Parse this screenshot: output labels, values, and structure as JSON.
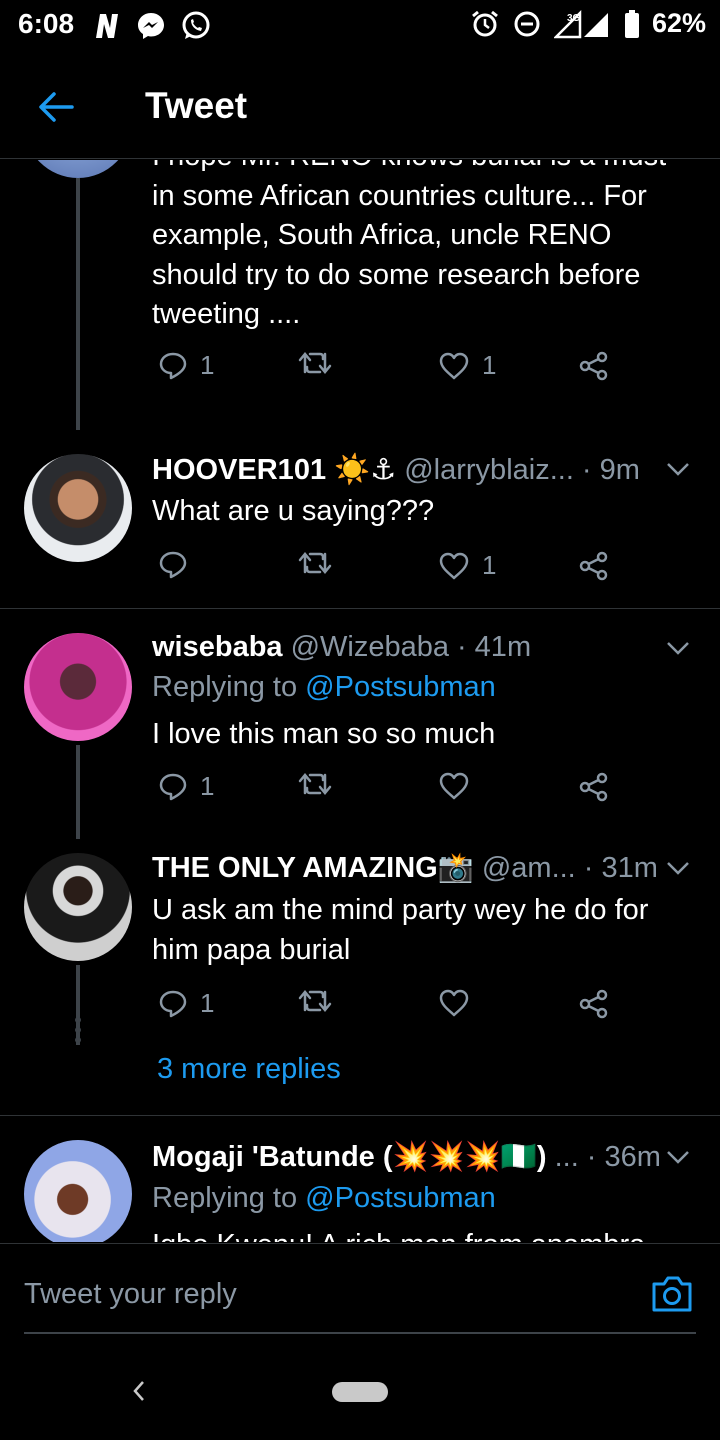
{
  "status_bar": {
    "time": "6:08",
    "network": "3G",
    "battery": "62%",
    "icons": [
      "netflix-icon",
      "messenger-icon",
      "whatsapp-icon",
      "alarm-icon",
      "dnd-icon",
      "signal-icon",
      "battery-icon"
    ]
  },
  "header": {
    "title": "Tweet",
    "back_icon": "arrow-left-icon"
  },
  "colors": {
    "accent": "#1d9bf0",
    "secondary_text": "#8b98a5",
    "background": "#000000",
    "divider": "#2f3336"
  },
  "tweets": [
    {
      "body": "I hope Mr. RENO knows burial is a must in some African countries culture... For example, South Africa, uncle RENO should try to do some research before tweeting ....",
      "replies": "1",
      "retweets": "",
      "likes": "1"
    },
    {
      "name": "HOOVER101 ☀️⚓",
      "handle": "@larryblaiz...",
      "time": "· 9m",
      "body": "What are u saying???",
      "replies": "",
      "retweets": "",
      "likes": "1"
    },
    {
      "name": "wisebaba",
      "handle": "@Wizebaba",
      "time": "· 41m",
      "replying_prefix": "Replying to",
      "replying_to": "@Postsubman",
      "body": "I love this man so so much",
      "replies": "1",
      "retweets": "",
      "likes": ""
    },
    {
      "name": "THE ONLY AMAZING📸",
      "handle": "@am...",
      "time": "· 31m",
      "body": "U ask am the mind party wey he do for him papa burial",
      "replies": "1",
      "retweets": "",
      "likes": ""
    },
    {
      "name": "Mogaji 'Batunde (💥💥💥🇳🇬)",
      "handle": "...",
      "time": "· 36m",
      "replying_prefix": "Replying to",
      "replying_to": "@Postsubman",
      "body": "Igbo Kwenu! A rich man from anambra"
    }
  ],
  "more_replies": "3 more replies",
  "reply_bar": {
    "placeholder": "Tweet your reply",
    "icon": "camera-icon"
  }
}
